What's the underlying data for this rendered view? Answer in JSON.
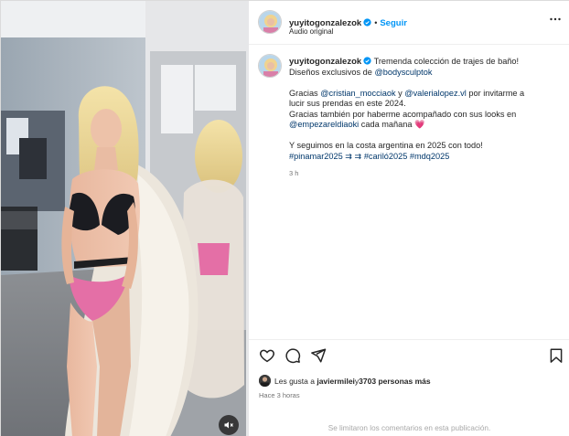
{
  "header": {
    "username": "yuyitogonzalezok",
    "separator": "•",
    "follow_label": "Seguir",
    "audio_label": "Audio original"
  },
  "caption": {
    "username": "yuyitogonzalezok",
    "line1_text": "Tremenda colección de trajes de baño!",
    "line2_prefix": "Diseños exclusivos de ",
    "mention_brand": "@bodysculptok",
    "line3_prefix": "Gracias ",
    "mention_1": "@cristian_mocciaok",
    "line3_and": " y ",
    "mention_2": "@valerialopez.vl",
    "line3_suffix": " por invitarme a",
    "line4": "lucir sus prendas en este 2024.",
    "line5": "Gracias también por haberme acompañado con sus looks en",
    "mention_3": "@empezareldiaoki",
    "line6_suffix": " cada mañana 💗",
    "line7": "Y seguimos en la costa argentina en 2025 con todo!",
    "hashtag_1": "#pinamar2025",
    "arrows": " ⇉ ⇉ ",
    "hashtag_2": "#cariló2025",
    "hashtag_3": "#mdq2025",
    "timestamp": "3 h"
  },
  "actions": {
    "likes_prefix": "Les gusta a ",
    "likes_user": "javiermilei",
    "likes_middle": " y ",
    "likes_count": "3703 personas más",
    "time_ago": "Hace 3 horas",
    "comments_disabled": "Se limitaron los comentarios en esta publicación."
  },
  "icons": {
    "more": "more-horizontal-icon",
    "like": "heart-icon",
    "comment": "comment-icon",
    "share": "share-icon",
    "save": "bookmark-icon",
    "mute": "speaker-muted-icon",
    "verified": "verified-badge-icon"
  },
  "colors": {
    "link": "#0095f6",
    "mention": "#00376b",
    "verified": "#0095f6",
    "muted_text": "#737373"
  }
}
